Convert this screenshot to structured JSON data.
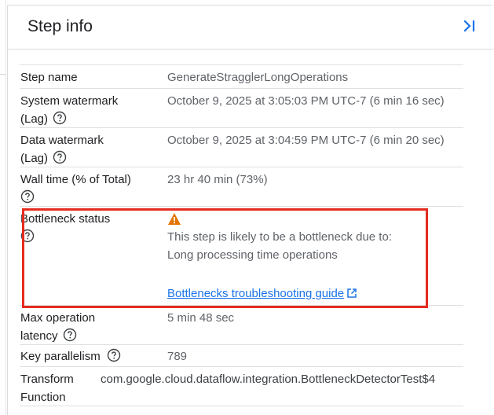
{
  "panel": {
    "title": "Step info",
    "collapse_icon": "collapse-panel-icon"
  },
  "rows": {
    "step_name": {
      "label": "Step name",
      "value": "GenerateStragglerLongOperations"
    },
    "system_watermark": {
      "label_line1": "System watermark",
      "label_line2": "(Lag)",
      "value": "October 9, 2025 at 3:05:03 PM UTC-7 (6 min 16 sec)"
    },
    "data_watermark": {
      "label_line1": "Data watermark",
      "label_line2": "(Lag)",
      "value": "October 9, 2025 at 3:04:59 PM UTC-7 (6 min 20 sec)"
    },
    "wall_time": {
      "label": "Wall time (% of Total)",
      "value": "23 hr 40 min (73%)"
    },
    "bottleneck": {
      "label": "Bottleneck status",
      "line1": "This step is likely to be a bottleneck due to:",
      "line2": "Long processing time operations",
      "link": "Bottlenecks troubleshooting guide"
    },
    "max_operation_latency": {
      "label_line1": "Max operation",
      "label_line2": "latency",
      "value": "5 min 48 sec"
    },
    "key_parallelism": {
      "label": "Key parallelism",
      "value": "789"
    },
    "transform_function": {
      "label_line1": "Transform",
      "label_line2": "Function",
      "value": "com.google.cloud.dataflow.integration.BottleneckDetectorTest$4"
    }
  },
  "colors": {
    "highlight": "#e52b20",
    "link": "#1a73e8",
    "warning": "#e37400",
    "muted_text": "#5f6368"
  }
}
